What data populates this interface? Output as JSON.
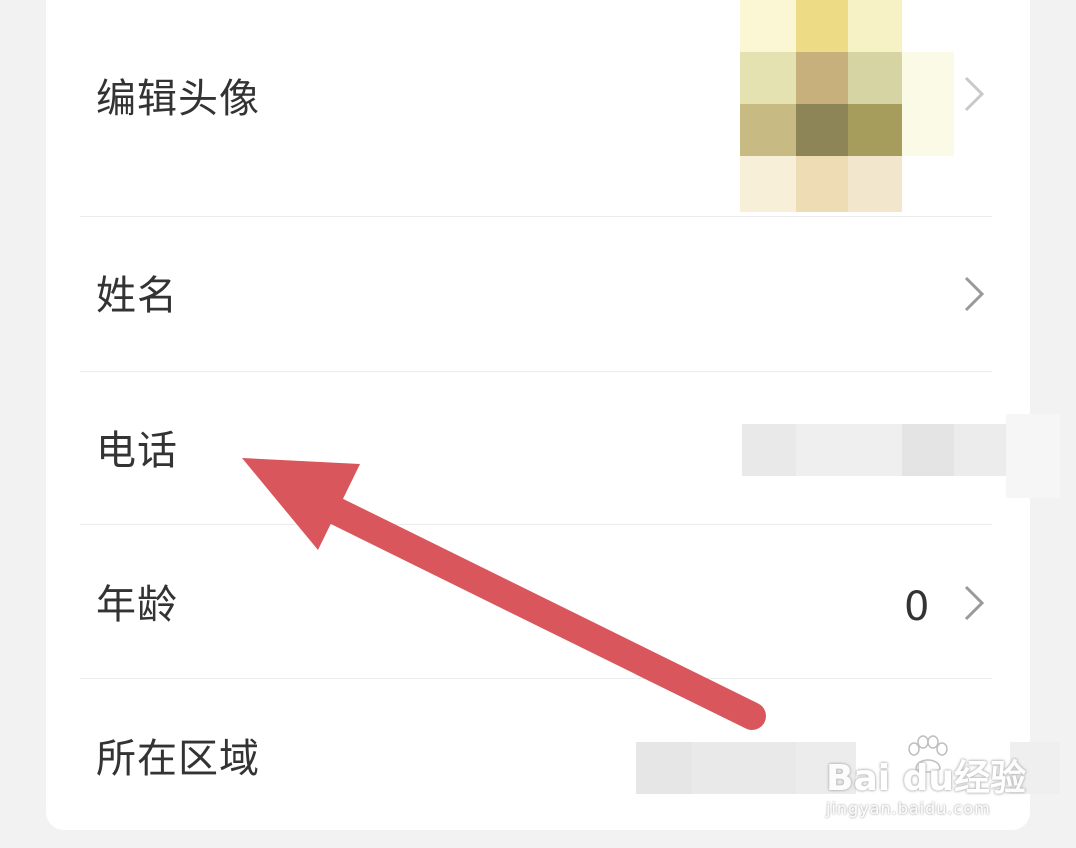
{
  "profile_rows": [
    {
      "label": "编辑头像"
    },
    {
      "label": "姓名"
    },
    {
      "label": "电话"
    },
    {
      "label": "年龄",
      "value": "0"
    },
    {
      "label": "所在区域"
    }
  ],
  "watermark": {
    "brand": "Bai du经验",
    "url": "jingyan.baidu.com"
  },
  "colors": {
    "background": "#f2f2f2",
    "card": "#ffffff",
    "text": "#333333",
    "chevron": "#9a9a9a",
    "arrow": "#d9565d"
  },
  "icons": {
    "chevron": "chevron-right-icon",
    "annotation": "red-arrow-annotation",
    "logo": "baidu-paw-icon"
  }
}
